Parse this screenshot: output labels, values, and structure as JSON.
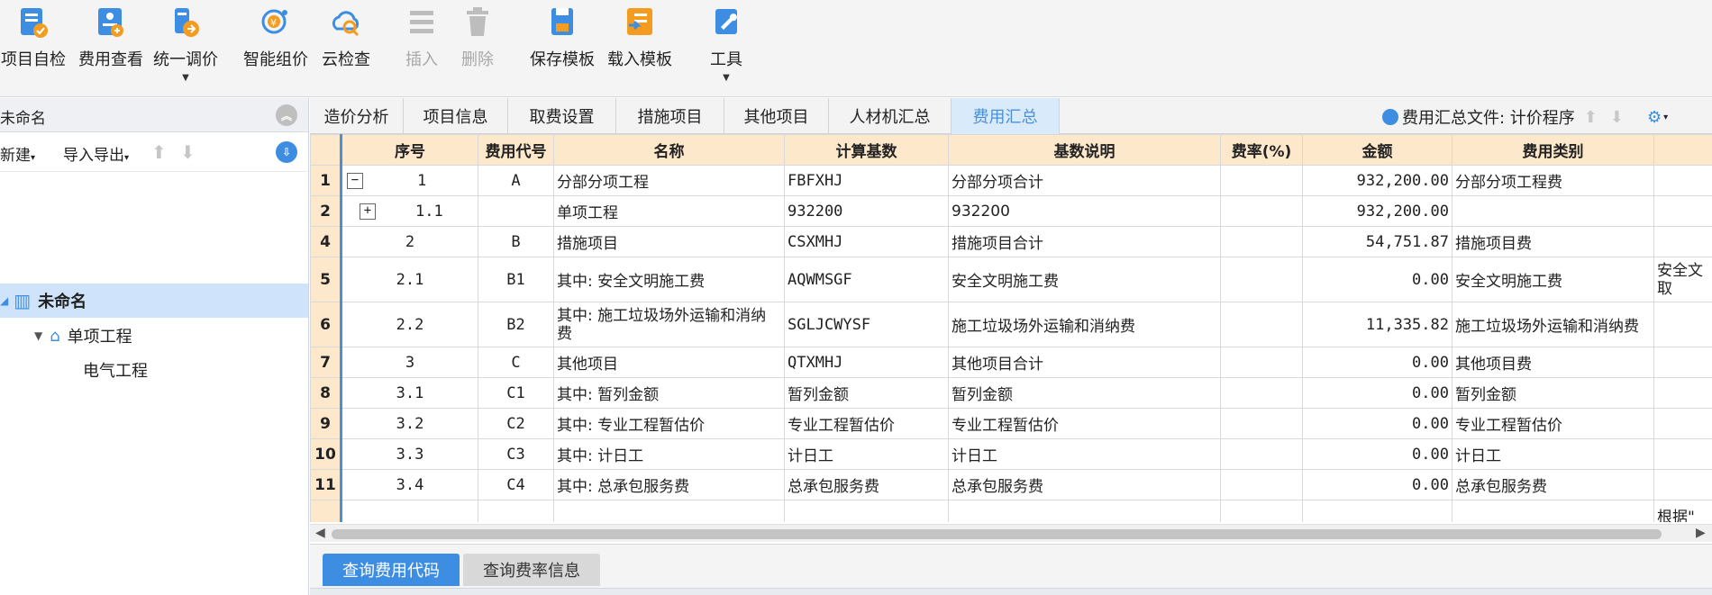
{
  "toolbar": {
    "buttons": [
      {
        "label": "项目自检",
        "icon": "self-check-icon"
      },
      {
        "label": "费用查看",
        "icon": "cost-view-icon"
      },
      {
        "label": "统一调价",
        "icon": "unified-price-icon"
      },
      {
        "label": "智能组价",
        "icon": "smart-pricing-icon"
      },
      {
        "label": "云检查",
        "icon": "cloud-check-icon"
      },
      {
        "label": "插入",
        "icon": "insert-icon"
      },
      {
        "label": "删除",
        "icon": "delete-icon"
      },
      {
        "label": "保存模板",
        "icon": "save-template-icon"
      },
      {
        "label": "载入模板",
        "icon": "load-template-icon"
      },
      {
        "label": "工具",
        "icon": "tools-icon"
      }
    ]
  },
  "left": {
    "title": "未命名",
    "new_label": "新建",
    "import_export_label": "导入导出",
    "tree": [
      {
        "label": "未命名",
        "icon": "building-icon"
      },
      {
        "label": "单项工程",
        "icon": "home-icon"
      },
      {
        "label": "电气工程"
      }
    ]
  },
  "tabs": [
    "造价分析",
    "项目信息",
    "取费设置",
    "措施项目",
    "其他项目",
    "人材机汇总",
    "费用汇总"
  ],
  "active_tab": "费用汇总",
  "summary_file": {
    "label": "费用汇总文件: 计价程序"
  },
  "grid": {
    "columns": [
      "序号",
      "费用代号",
      "名称",
      "计算基数",
      "基数说明",
      "费率(%)",
      "金额",
      "费用类别"
    ],
    "rows": [
      {
        "rn": "1",
        "seq": "1",
        "code": "A",
        "name": "分部分项工程",
        "base": "FBFXHJ",
        "desc": "分部分项合计",
        "rate": "",
        "amount": "932,200.00",
        "category": "分部分项工程费",
        "extra": ""
      },
      {
        "rn": "2",
        "seq": "1.1",
        "code": "",
        "name": "单项工程",
        "base": "932200",
        "desc": "932200",
        "rate": "",
        "amount": "932,200.00",
        "category": "",
        "extra": ""
      },
      {
        "rn": "4",
        "seq": "2",
        "code": "B",
        "name": "措施项目",
        "base": "CSXMHJ",
        "desc": "措施项目合计",
        "rate": "",
        "amount": "54,751.87",
        "category": "措施项目费",
        "extra": ""
      },
      {
        "rn": "5",
        "seq": "2.1",
        "code": "B1",
        "name": "其中: 安全文明施工费",
        "base": "AQWMSGF",
        "desc": "安全文明施工费",
        "rate": "",
        "amount": "0.00",
        "category": "安全文明施工费",
        "extra": "安全文\n取"
      },
      {
        "rn": "6",
        "seq": "2.2",
        "code": "B2",
        "name": "其中: 施工垃圾场外运输和消纳费",
        "base": "SGLJCWYSF",
        "desc": "施工垃圾场外运输和消纳费",
        "rate": "",
        "amount": "11,335.82",
        "category": "施工垃圾场外运输和消纳费",
        "extra": ""
      },
      {
        "rn": "7",
        "seq": "3",
        "code": "C",
        "name": "其他项目",
        "base": "QTXMHJ",
        "desc": "其他项目合计",
        "rate": "",
        "amount": "0.00",
        "category": "其他项目费",
        "extra": ""
      },
      {
        "rn": "8",
        "seq": "3.1",
        "code": "C1",
        "name": "其中: 暂列金额",
        "base": "暂列金额",
        "desc": "暂列金额",
        "rate": "",
        "amount": "0.00",
        "category": "暂列金额",
        "extra": ""
      },
      {
        "rn": "9",
        "seq": "3.2",
        "code": "C2",
        "name": "其中: 专业工程暂估价",
        "base": "专业工程暂估价",
        "desc": "专业工程暂估价",
        "rate": "",
        "amount": "0.00",
        "category": "专业工程暂估价",
        "extra": ""
      },
      {
        "rn": "10",
        "seq": "3.3",
        "code": "C3",
        "name": "其中: 计日工",
        "base": "计日工",
        "desc": "计日工",
        "rate": "",
        "amount": "0.00",
        "category": "计日工",
        "extra": ""
      },
      {
        "rn": "11",
        "seq": "3.4",
        "code": "C4",
        "name": "其中: 总承包服务费",
        "base": "总承包服务费",
        "desc": "总承包服务费",
        "rate": "",
        "amount": "0.00",
        "category": "总承包服务费",
        "extra": ""
      },
      {
        "rn": "",
        "seq": "",
        "code": "",
        "name": "",
        "base": "",
        "desc": "",
        "rate": "",
        "amount": "",
        "category": "",
        "extra": "根据\""
      }
    ]
  },
  "bottom_tabs": [
    "查询费用代码",
    "查询费率信息"
  ],
  "colors": {
    "accent": "#3d8ee3",
    "header_bg": "#fde8cc",
    "selected_tree": "#cfe4fb"
  }
}
